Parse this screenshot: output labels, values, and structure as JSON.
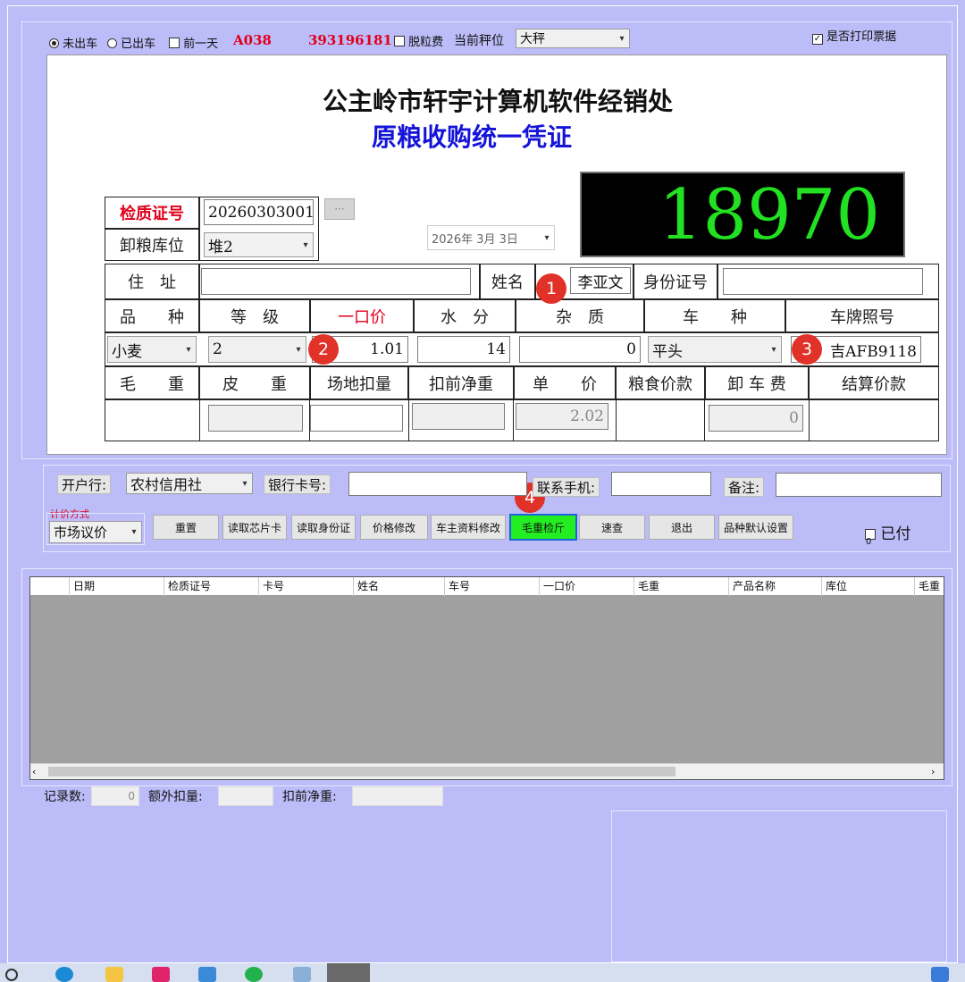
{
  "toolbar": {
    "radio_not_out": "未出车",
    "radio_out": "已出车",
    "prev_day": "前一天",
    "code": "A038",
    "number": "393196181",
    "husk_fee": "脱粒费",
    "scale_label": "当前秤位",
    "scale_value": "大秤",
    "print_ticket": "是否打印票据"
  },
  "header": {
    "company": "公主岭市轩宇计算机软件经销处",
    "doc_title": "原粮收购统一凭证",
    "weight_display": "18970"
  },
  "form": {
    "cert_label": "检质证号",
    "cert_value": "20260303001",
    "cert_button": "···",
    "store_label": "卸粮库位",
    "store_value": "堆2",
    "date_value": "2026年 3月 3日",
    "addr_label": "住　址",
    "name_label": "姓名",
    "name_value": "李亚文",
    "id_label": "身份证号",
    "col_variety": "品　　种",
    "col_grade": "等　级",
    "col_price": "一口价",
    "col_water": "水　分",
    "col_impurity": "杂　质",
    "col_vehicle": "车　　种",
    "col_plate": "车牌照号",
    "variety_value": "小麦",
    "grade_value": "2",
    "price_value": "1.01",
    "water_value": "14",
    "impurity_value": "0",
    "vehicle_value": "平头",
    "plate_value": "吉AFB9118",
    "col_gross": "毛　　重",
    "col_tare": "皮　　重",
    "col_site": "场地扣量",
    "col_prenet": "扣前净重",
    "col_unit": "单　　价",
    "col_grain_pay": "粮食价款",
    "col_unload": "卸 车 费",
    "col_settle": "结算价款",
    "unit_value": "2.02",
    "unload_value": "0"
  },
  "badges": [
    "1",
    "2",
    "3",
    "4"
  ],
  "bank": {
    "bank_label": "开户行:",
    "bank_value": "农村信用社",
    "card_label": "银行卡号:",
    "phone_label": "联系手机:",
    "note_label": "备注:"
  },
  "actions": {
    "pricing_label": "计价方式",
    "pricing_value": "市场议价",
    "reset": "重置",
    "read_chip": "读取芯片卡",
    "read_id": "读取身份证",
    "price_edit": "价格修改",
    "owner_edit": "车主资料修改",
    "gross_weigh": "毛重检斤",
    "quick_query": "速查",
    "exit": "退出",
    "variety_default": "品种默认设置",
    "paid": "已付",
    "paid_count": "0"
  },
  "grid": {
    "columns": [
      "日期",
      "检质证号",
      "卡号",
      "姓名",
      "车号",
      "一口价",
      "毛重",
      "产品名称",
      "库位",
      "毛重"
    ]
  },
  "footer": {
    "records_label": "记录数:",
    "records_value": "0",
    "extra_label": "额外扣量:",
    "prenet_label": "扣前净重:"
  }
}
